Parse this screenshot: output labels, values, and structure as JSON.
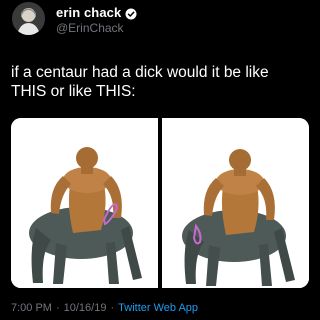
{
  "author": {
    "display_name": "erin chack",
    "handle": "@ErinChack",
    "verified": true,
    "avatar_icon": "profile-photo"
  },
  "tweet": {
    "line1": "if a centaur had a dick would it be like",
    "line2": "THIS or like THIS:"
  },
  "media": [
    {
      "alt_icon": "centaur-image",
      "marker": "upright"
    },
    {
      "alt_icon": "centaur-image",
      "marker": "lower"
    }
  ],
  "meta": {
    "time": "7:00 PM",
    "separator1": "·",
    "date": "10/16/19",
    "separator2": "·",
    "source": "Twitter Web App"
  },
  "colors": {
    "background": "#000000",
    "text": "#ffffff",
    "muted": "#71767b",
    "accent": "#1d9bf0",
    "highlight": "#c66ad0"
  }
}
